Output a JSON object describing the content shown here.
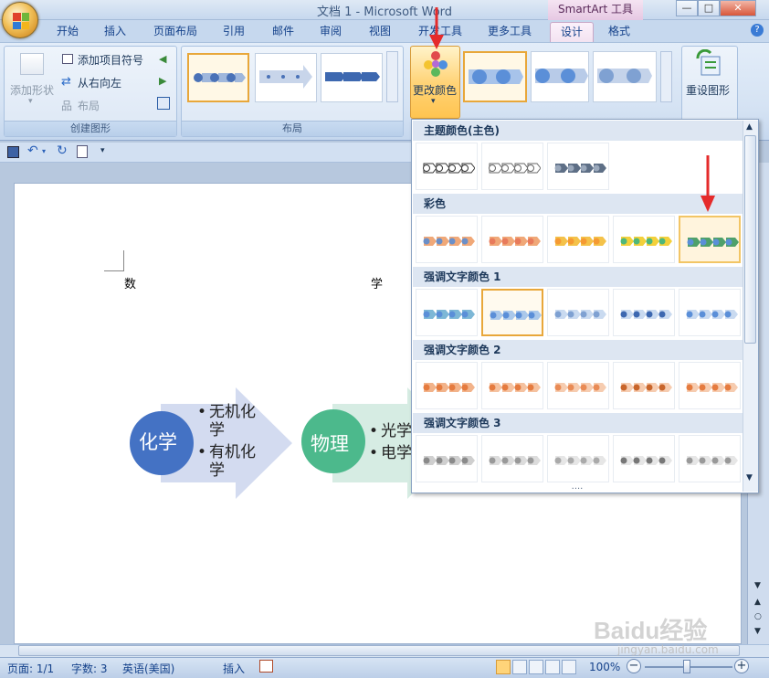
{
  "window": {
    "title": "文档 1 - Microsoft Word",
    "context_tab_group": "SmartArt 工具",
    "controls": {
      "minimize": "—",
      "maximize": "□",
      "close": "✕"
    }
  },
  "tabs": [
    {
      "label": "开始"
    },
    {
      "label": "插入"
    },
    {
      "label": "页面布局"
    },
    {
      "label": "引用"
    },
    {
      "label": "邮件"
    },
    {
      "label": "审阅"
    },
    {
      "label": "视图"
    },
    {
      "label": "开发工具"
    },
    {
      "label": "更多工具"
    },
    {
      "label": "设计"
    },
    {
      "label": "格式"
    }
  ],
  "help_icon": "?",
  "ribbon": {
    "create_graphic": {
      "label": "创建图形",
      "add_shape": "添加形状",
      "add_bullet": "添加项目符号",
      "right_to_left": "从右向左",
      "layout": "布局"
    },
    "layouts": {
      "label": "布局"
    },
    "change_colors": "更改颜色",
    "reset_graphic": "重设图形"
  },
  "document": {
    "text_left": "数",
    "text_right": "学",
    "smartart": [
      {
        "circle_label": "化学",
        "bullets": [
          "无机化",
          "学",
          "有机化",
          "学"
        ],
        "circle_color": "#4472c4",
        "arrow_color": "#d3dbf0"
      },
      {
        "circle_label": "物理",
        "bullets": [
          "光学",
          "电学"
        ],
        "circle_color": "#4cb98c",
        "arrow_color": "#d6ece3"
      }
    ],
    "bullet_char": "•"
  },
  "color_dropdown": {
    "sections": [
      {
        "title": "主题颜色(主色)",
        "count": 3
      },
      {
        "title": "彩色",
        "count": 5
      },
      {
        "title": "强调文字颜色 1",
        "count": 5
      },
      {
        "title": "强调文字颜色 2",
        "count": 5
      },
      {
        "title": "强调文字颜色 3",
        "count": 5
      }
    ],
    "footer": "....",
    "selected_section": 2,
    "hovered_section": 1,
    "hovered_index": 4,
    "selected_index": 1
  },
  "statusbar": {
    "page": "页面: 1/1",
    "words": "字数: 3",
    "language": "英语(美国)",
    "insert": "插入",
    "zoom": "100%",
    "minus": "−",
    "plus": "+"
  },
  "watermark": {
    "brand": "Baidu经验",
    "url": "jingyan.baidu.com"
  }
}
